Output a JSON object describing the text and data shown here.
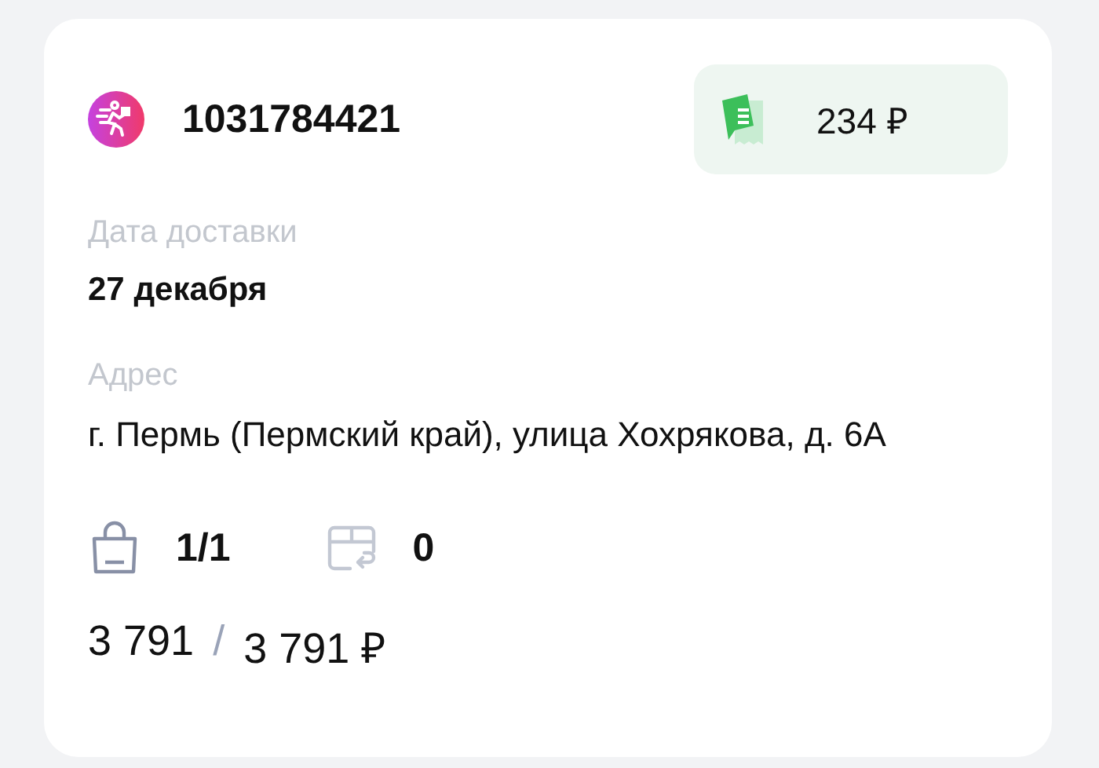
{
  "order": {
    "number": "1031784421",
    "fee": "234 ₽"
  },
  "fields": [
    {
      "label": "Дата доставки",
      "value": "27 декабря",
      "kind": "date"
    },
    {
      "label": "Адрес",
      "value": "г. Пермь (Пермский край), улица Хохрякова, д. 6А",
      "kind": "address"
    }
  ],
  "counts": [
    {
      "kind": "items",
      "value": "1/1"
    },
    {
      "kind": "returns",
      "value": "0"
    }
  ],
  "amount": {
    "paid": "3 791",
    "separator": "/",
    "total": "3 791 ₽"
  }
}
